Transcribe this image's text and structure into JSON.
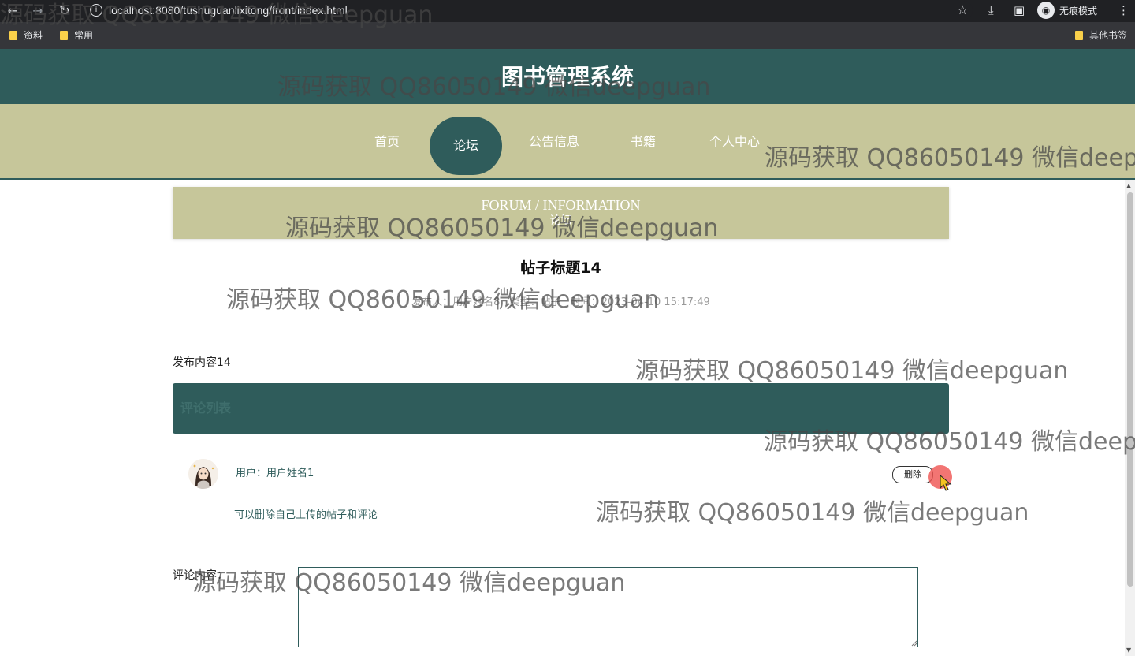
{
  "browser": {
    "url": "localhost:8080/tushuguanlixitong/front/index.html",
    "mode_label": "无痕模式",
    "bookmarks": [
      "资料",
      "常用"
    ],
    "other_bookmarks": "其他书签"
  },
  "site": {
    "title": "图书管理系统",
    "nav": [
      "首页",
      "论坛",
      "公告信息",
      "书籍",
      "个人中心"
    ],
    "active_nav": "论坛"
  },
  "banner": {
    "en": "FORUM / INFORMATION",
    "cn": "论坛"
  },
  "post": {
    "title": "帖子标题14",
    "meta_author": "发布人：用户姓名8",
    "meta_type": "类型：帖子",
    "meta_time": "时间：2023-04-10 15:17:49",
    "content": "发布内容14"
  },
  "comments": {
    "header": "评论列表",
    "items": [
      {
        "user": "用户：用户姓名1",
        "text": "可以删除自己上传的帖子和评论",
        "delete_label": "删除"
      }
    ]
  },
  "reply": {
    "label": "评论内容：",
    "value": ""
  },
  "watermark": "源码获取 QQ86050149 微信deepguan",
  "colors": {
    "primary": "#2f5c5b",
    "secondary": "#c6c69a",
    "chrome": "#202124"
  }
}
